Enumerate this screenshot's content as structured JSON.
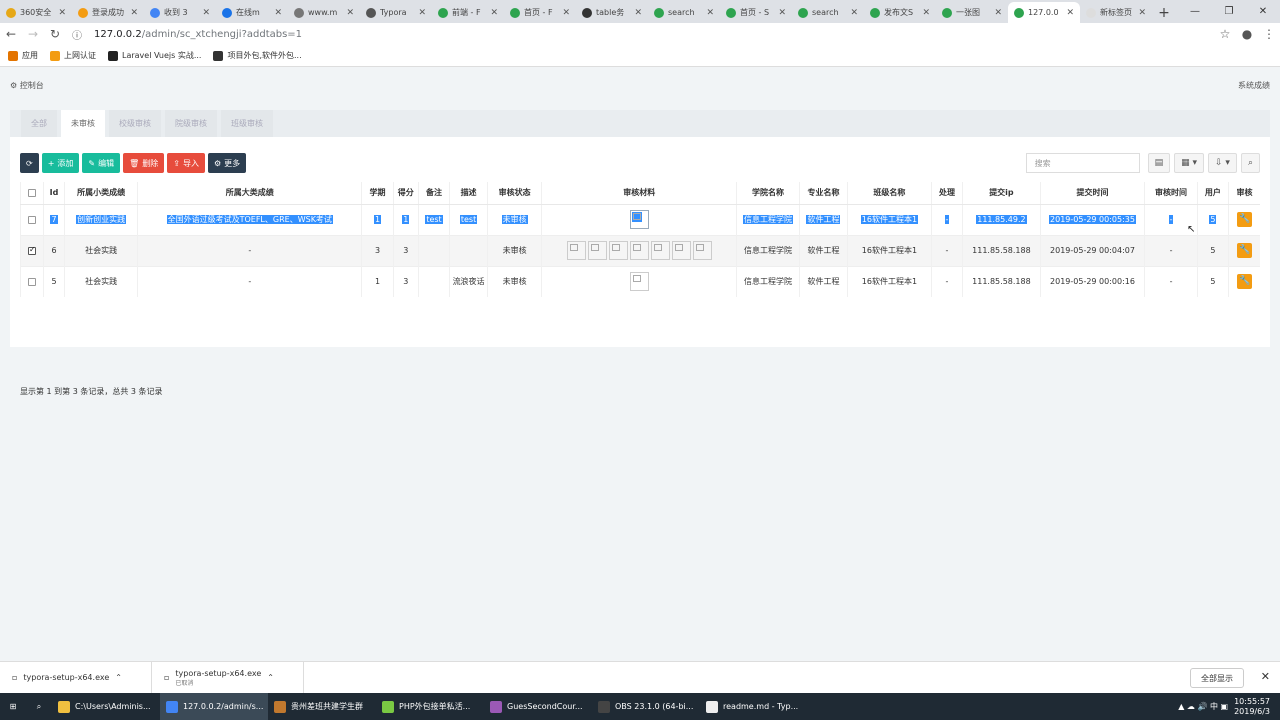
{
  "browser": {
    "tabs": [
      {
        "label": "360安全",
        "color": "#e6a817"
      },
      {
        "label": "登录成功",
        "color": "#f39c12"
      },
      {
        "label": "收到 3",
        "color": "#4285f4"
      },
      {
        "label": "在线m",
        "color": "#1a73e8"
      },
      {
        "label": "www.m",
        "color": "#777777"
      },
      {
        "label": "Typora",
        "color": "#555555"
      },
      {
        "label": "前端 - F",
        "color": "#2ea44f"
      },
      {
        "label": "首页 - F",
        "color": "#2ea44f"
      },
      {
        "label": "table务",
        "color": "#333333"
      },
      {
        "label": "search",
        "color": "#2ea44f"
      },
      {
        "label": "首页 - S",
        "color": "#2ea44f"
      },
      {
        "label": "search",
        "color": "#2ea44f"
      },
      {
        "label": "发布文S",
        "color": "#2ea44f"
      },
      {
        "label": "一张图",
        "color": "#2ea44f"
      },
      {
        "label": "127.0.0",
        "color": "#2ea44f",
        "active": true
      },
      {
        "label": "新标签页",
        "color": "#dddddd"
      }
    ],
    "url_host": "127.0.0.2",
    "url_path": "/admin/sc_xtchengji?addtabs=1",
    "bookmarks": [
      "应用",
      "上网认证",
      "Laravel Vuejs 实战...",
      "项目外包,软件外包..."
    ]
  },
  "page": {
    "crumb": "控制台",
    "crumb_right": "系统成绩",
    "subtabs": [
      "全部",
      "未审核",
      "校级审核",
      "院级审核",
      "班级审核"
    ],
    "active_subtab": 1,
    "toolbar": {
      "refresh": "",
      "add": "添加",
      "edit": "编辑",
      "delete": "删除",
      "import": "导入",
      "more": "更多"
    },
    "search_placeholder": "搜索",
    "columns": [
      "",
      "Id",
      "所属小类成绩",
      "所属大类成绩",
      "学期",
      "得分",
      "备注",
      "描述",
      "审核状态",
      "审核材料",
      "学院名称",
      "专业名称",
      "班级名称",
      "处理",
      "提交ip",
      "提交时间",
      "审核时间",
      "用户",
      "审核"
    ],
    "rows": [
      {
        "checked": false,
        "id": "7",
        "small": "创新创业实践",
        "big": "全国外语过级考试及TOEFL、GRE、WSK考试",
        "term": "1",
        "score": "1",
        "note": "test",
        "desc": "test",
        "status": "未审核",
        "images": 1,
        "college": "信息工程学院",
        "major": "软件工程",
        "cls": "16软件工程本1",
        "handle": "-",
        "ip": "111.85.49.2",
        "time": "2019-05-29 00:05:35",
        "audit_time": "-",
        "user": "5",
        "selected": true
      },
      {
        "checked": true,
        "id": "6",
        "small": "社会实践",
        "big": "-",
        "term": "3",
        "score": "3",
        "note": "",
        "desc": "",
        "status": "未审核",
        "images": 7,
        "college": "信息工程学院",
        "major": "软件工程",
        "cls": "16软件工程本1",
        "handle": "-",
        "ip": "111.85.58.188",
        "time": "2019-05-29 00:04:07",
        "audit_time": "-",
        "user": "5",
        "selected": false
      },
      {
        "checked": false,
        "id": "5",
        "small": "社会实践",
        "big": "-",
        "term": "1",
        "score": "3",
        "note": "",
        "desc": "流浪夜话",
        "status": "未审核",
        "images": 1,
        "college": "信息工程学院",
        "major": "软件工程",
        "cls": "16软件工程本1",
        "handle": "-",
        "ip": "111.85.58.188",
        "time": "2019-05-29 00:00:16",
        "audit_time": "-",
        "user": "5",
        "selected": false
      }
    ],
    "footer": "显示第 1 到第 3 条记录，总共 3 条记录"
  },
  "downloads": {
    "items": [
      {
        "name": "typora-setup-x64.exe",
        "sub": ""
      },
      {
        "name": "typora-setup-x64.exe",
        "sub": "已取消"
      }
    ],
    "show_all": "全部显示"
  },
  "taskbar": {
    "items": [
      {
        "label": "C:\\Users\\Adminis...",
        "color": "#f0c040"
      },
      {
        "label": "127.0.0.2/admin/s...",
        "color": "#4285f4",
        "active": true
      },
      {
        "label": "贵州差班共建学生群",
        "color": "#c0782e"
      },
      {
        "label": "PHP外包接单私活...",
        "color": "#7ac943"
      },
      {
        "label": "GuesSecondCour...",
        "color": "#9b59b6"
      },
      {
        "label": "OBS 23.1.0 (64-bi...",
        "color": "#444444"
      },
      {
        "label": "readme.md - Typ...",
        "color": "#eeeeee"
      }
    ],
    "time": "10:55:57",
    "date": "2019/6/3"
  }
}
